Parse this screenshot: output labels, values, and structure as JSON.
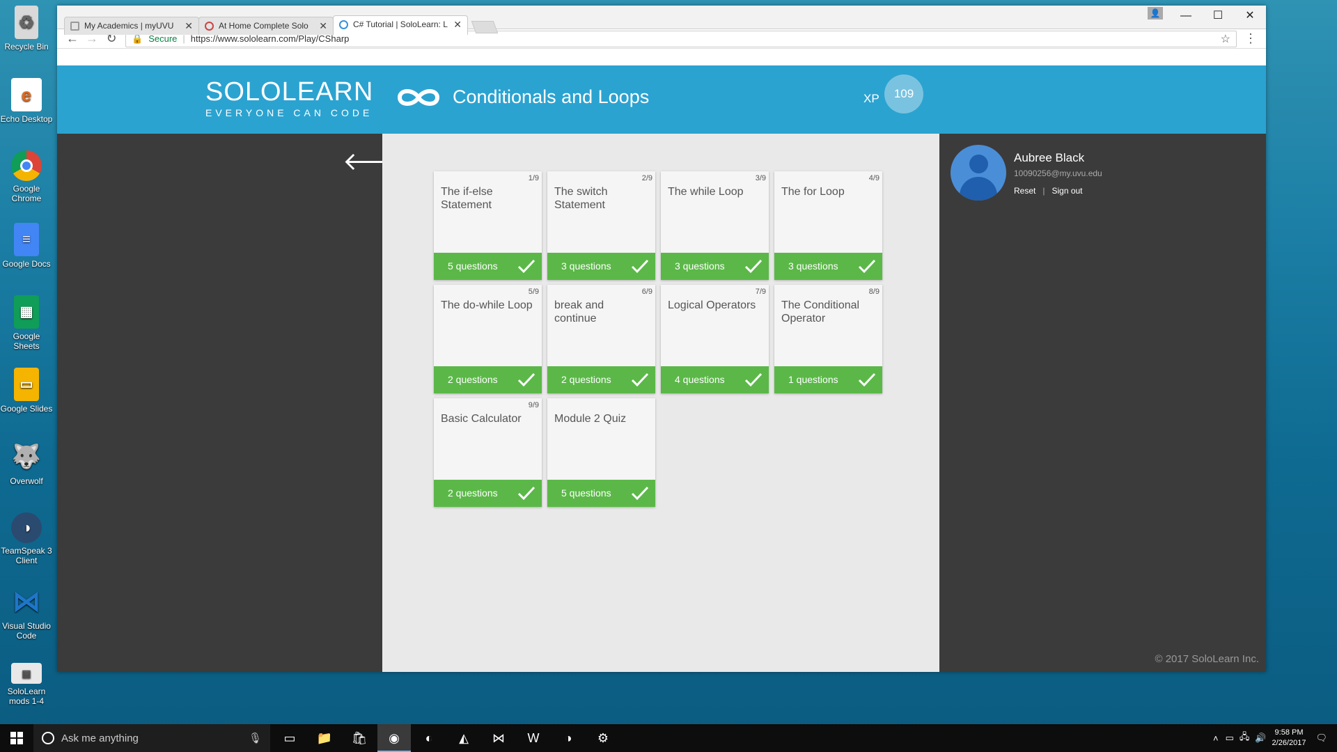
{
  "desktop": {
    "icons": [
      {
        "label": "Recycle Bin",
        "icon": "recycle-bin-icon",
        "color": "#d9d9d9"
      },
      {
        "label": "Echo Desktop",
        "icon": "echo-desktop-icon",
        "color": "#e06a1d"
      },
      {
        "label": "Google Chrome",
        "icon": "chrome-icon",
        "color": "#db4437"
      },
      {
        "label": "Google Docs",
        "icon": "google-docs-icon",
        "color": "#4285f4"
      },
      {
        "label": "Google Sheets",
        "icon": "google-sheets-icon",
        "color": "#0f9d58"
      },
      {
        "label": "Google Slides",
        "icon": "google-slides-icon",
        "color": "#f4b400"
      },
      {
        "label": "Overwolf",
        "icon": "overwolf-icon",
        "color": "#222222"
      },
      {
        "label": "TeamSpeak 3 Client",
        "icon": "teamspeak-icon",
        "color": "#2b4a6f"
      },
      {
        "label": "Visual Studio Code",
        "icon": "vscode-icon",
        "color": "#1e76c8"
      },
      {
        "label": "SoloLearn mods 1-4",
        "icon": "sololearn-file-icon",
        "color": "#e8e8e8"
      }
    ]
  },
  "browser": {
    "tabs": [
      {
        "title": "My Academics | myUVU",
        "active": false
      },
      {
        "title": "At Home Complete Solo",
        "active": false
      },
      {
        "title": "C# Tutorial | SoloLearn: L",
        "active": true
      }
    ],
    "secure_label": "Secure",
    "url": "https://www.sololearn.com/Play/CSharp"
  },
  "header": {
    "logo_main": "SOLOLEARN",
    "logo_tagline": "EVERYONE CAN CODE",
    "module_title": "Conditionals and Loops",
    "xp_label": "XP",
    "xp_value": "109",
    "accent_color": "#2ba3d1"
  },
  "user": {
    "name": "Aubree Black",
    "email": "10090256@my.uvu.edu",
    "reset_label": "Reset",
    "signout_label": "Sign out"
  },
  "lessons": [
    {
      "num": "1/9",
      "title": "The if-else Statement",
      "questions": "5 questions"
    },
    {
      "num": "2/9",
      "title": "The switch Statement",
      "questions": "3 questions"
    },
    {
      "num": "3/9",
      "title": "The while Loop",
      "questions": "3 questions"
    },
    {
      "num": "4/9",
      "title": "The for Loop",
      "questions": "3 questions"
    },
    {
      "num": "5/9",
      "title": "The do-while Loop",
      "questions": "2 questions"
    },
    {
      "num": "6/9",
      "title": "break and continue",
      "questions": "2 questions"
    },
    {
      "num": "7/9",
      "title": "Logical Operators",
      "questions": "4 questions"
    },
    {
      "num": "8/9",
      "title": "The Conditional Operator",
      "questions": "1 questions"
    },
    {
      "num": "9/9",
      "title": "Basic Calculator",
      "questions": "2 questions"
    },
    {
      "num": "",
      "title": "Module 2 Quiz",
      "questions": "5 questions"
    }
  ],
  "completed_color": "#5bb848",
  "footer": {
    "copyright": "© 2017 SoloLearn Inc."
  },
  "taskbar": {
    "search_placeholder": "Ask me anything",
    "time": "9:58 PM",
    "date": "2/26/2017"
  }
}
